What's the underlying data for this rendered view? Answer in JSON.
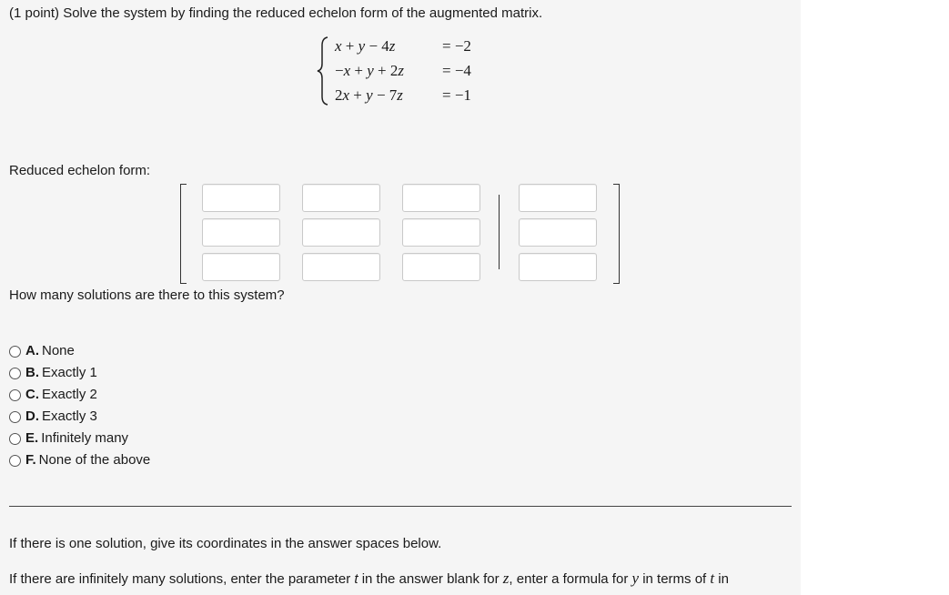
{
  "question": {
    "prompt": "(1 point) Solve the system by finding the reduced echelon form of the augmented matrix."
  },
  "system": {
    "rows": [
      {
        "lhs": "x + y − 4z",
        "rhs": "= −2"
      },
      {
        "lhs": "−x + y + 2z",
        "rhs": "= −4"
      },
      {
        "lhs": "2x + y − 7z",
        "rhs": "= −1"
      }
    ]
  },
  "rref": {
    "label": "Reduced echelon form:",
    "rows": 3,
    "cols": 4,
    "values": [
      [
        "",
        "",
        "",
        ""
      ],
      [
        "",
        "",
        "",
        ""
      ],
      [
        "",
        "",
        "",
        ""
      ]
    ]
  },
  "solutions_question": {
    "prompt": "How many solutions are there to this system?",
    "options": [
      {
        "letter": "A.",
        "text": "None"
      },
      {
        "letter": "B.",
        "text": "Exactly 1"
      },
      {
        "letter": "C.",
        "text": "Exactly 2"
      },
      {
        "letter": "D.",
        "text": "Exactly 3"
      },
      {
        "letter": "E.",
        "text": "Infinitely many"
      },
      {
        "letter": "F.",
        "text": "None of the above"
      }
    ]
  },
  "instructions": {
    "line1": "If there is one solution, give its coordinates in the answer spaces below.",
    "line2_a": "If there are infinitely many solutions, enter the parameter ",
    "line2_t": "t",
    "line2_b": " in the answer blank for ",
    "line2_z": "z",
    "line2_c": ", enter a formula for ",
    "line2_y": "y",
    "line2_d": " in terms of ",
    "line2_t2": "t",
    "line2_e": " in"
  }
}
